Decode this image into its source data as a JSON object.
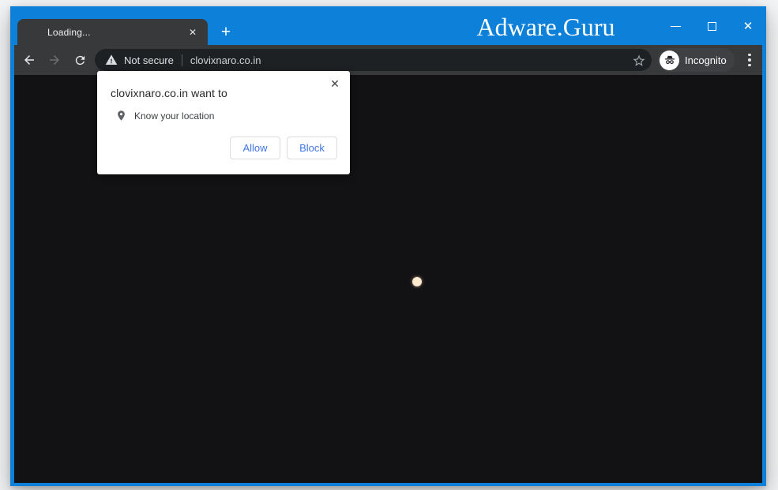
{
  "window": {
    "title": "Adware.Guru"
  },
  "tab_strip": {
    "active_tab": {
      "label": "Loading..."
    }
  },
  "toolbar": {
    "security_label": "Not secure",
    "url": "clovixnaro.co.in",
    "incognito_label": "Incognito"
  },
  "permission_popup": {
    "title": "clovixnaro.co.in want to",
    "request_label": "Know your location",
    "buttons": {
      "allow": "Allow",
      "block": "Block"
    }
  },
  "icons": {
    "tab_close": "✕",
    "new_tab": "+",
    "window_close": "✕",
    "popup_close": "✕"
  },
  "colors": {
    "titlebar_blue": "#0d80d9",
    "toolbar_gray": "#37393b",
    "omnibox_dark": "#1e2124",
    "page_background": "#121214",
    "action_blue": "#4077e4",
    "spinner_orange": "#ee8c3a"
  },
  "page": {
    "state": "loading"
  }
}
